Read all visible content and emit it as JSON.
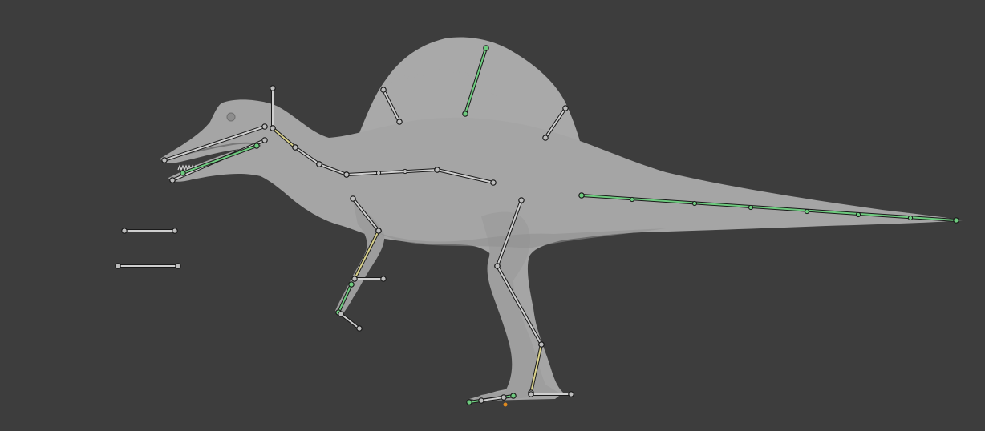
{
  "viewport": {
    "background_color": "#3d3d3d",
    "mesh_color": "#a7a7a7",
    "mesh_shade_color": "#8e8e8e",
    "bone_color": "#cfcfcf",
    "bone_outline_color": "#1a1a1a",
    "selected_bone_color": "#6ecb7f",
    "ik_bone_color": "#d9d18a",
    "origin_marker_color": "#e08a1e"
  },
  "model": {
    "icon": "spinosaurus-mesh"
  }
}
